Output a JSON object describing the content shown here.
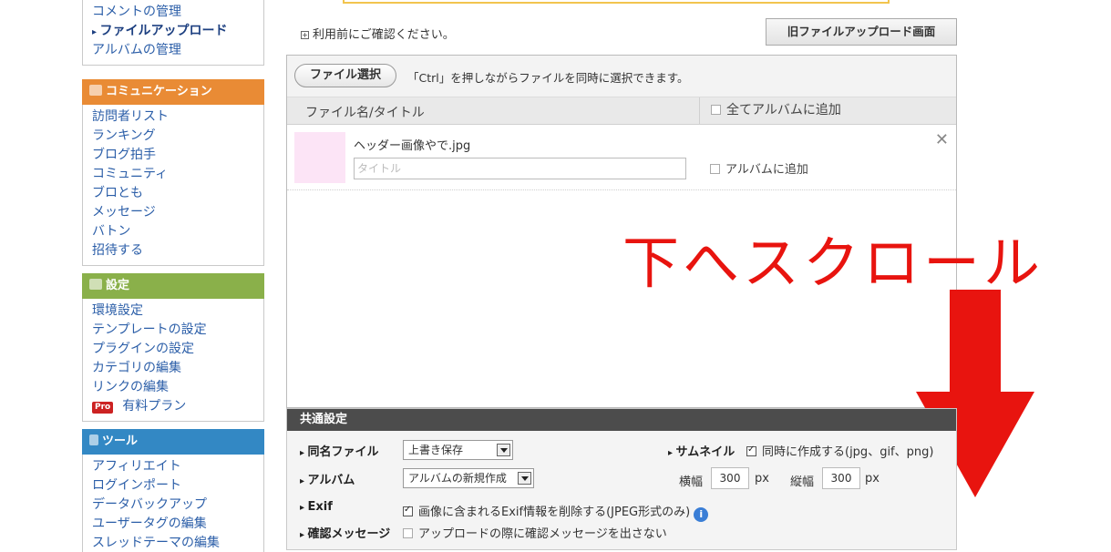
{
  "sidebar": {
    "blog_items": [
      "コメントの管理",
      "ファイルアップロード",
      "アルバムの管理"
    ],
    "communication": {
      "title": "コミュニケーション",
      "items": [
        "訪問者リスト",
        "ランキング",
        "ブログ拍手",
        "コミュニティ",
        "ブロとも",
        "メッセージ",
        "バトン",
        "招待する"
      ]
    },
    "settings": {
      "title": "設定",
      "items": [
        "環境設定",
        "テンプレートの設定",
        "プラグインの設定",
        "カテゴリの編集",
        "リンクの編集"
      ],
      "pro_badge": "Pro",
      "pro_label": "有料プラン"
    },
    "tools": {
      "title": "ツール",
      "items": [
        "アフィリエイト",
        "ログインポート",
        "データバックアップ",
        "ユーザータグの編集",
        "スレッドテーマの編集"
      ]
    }
  },
  "main": {
    "confirm_link": "利用前にご確認ください。",
    "old_upload_button": "旧ファイルアップロード画面",
    "file_select_button": "ファイル選択",
    "ctrl_hint": "「Ctrl」を押しながらファイルを同時に選択できます。",
    "col_filename": "ファイル名/タイトル",
    "col_add_all": "全てアルバムに追加",
    "file": {
      "name": "ヘッダー画像やで.jpg",
      "title_placeholder": "タイトル",
      "album_add_label": "アルバムに追加"
    },
    "scroll_annotation": "下へスクロール"
  },
  "common_settings": {
    "title": "共通設定",
    "same_name_label": "同名ファイル",
    "same_name_value": "上書き保存",
    "album_label": "アルバム",
    "album_value": "アルバムの新規作成",
    "thumbnail_label": "サムネイル",
    "thumbnail_option": "同時に作成する(jpg、gif、png)",
    "width_label": "横幅",
    "width_value": "300",
    "height_label": "縦幅",
    "height_value": "300",
    "unit": "px",
    "exif_label": "Exif",
    "exif_option": "画像に含まれるExif情報を削除する(JPEG形式のみ)",
    "confirm_label": "確認メッセージ",
    "confirm_option": "アップロードの際に確認メッセージを出さない"
  },
  "colors": {
    "accent_red": "#e8140f",
    "section_orange": "#e98b35",
    "section_green": "#8ab04a",
    "section_blue": "#3388c4"
  }
}
